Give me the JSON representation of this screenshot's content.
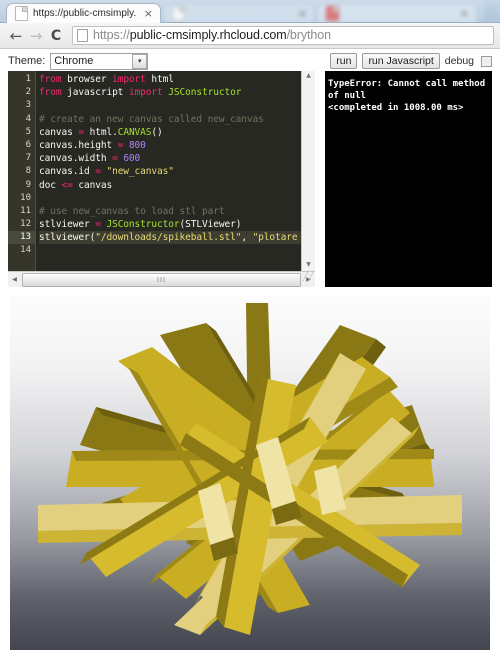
{
  "browser": {
    "tabs": [
      {
        "title": "https://public-cmsimply.",
        "close": "×",
        "state": "active"
      },
      {
        "title": "",
        "close": "×",
        "state": "blurred"
      },
      {
        "title": "",
        "close": "×",
        "state": "blurred"
      }
    ],
    "back_icon": "←",
    "forward_icon": "→",
    "reload_icon": "C",
    "url_scheme": "https://",
    "url_host": "public-cmsimply.rhcloud.com",
    "url_path": "/brython",
    "url_full": "https://public-cmsimply.rhcloud.com/brython"
  },
  "ide": {
    "theme_label": "Theme:",
    "theme_value": "Chrome",
    "theme_arrow": "▾",
    "run_label": "run",
    "run_js_label": "run Javascript",
    "debug_label": "debug"
  },
  "editor": {
    "line_numbers": [
      "1",
      "2",
      "3",
      "4",
      "5",
      "6",
      "7",
      "8",
      "9",
      "10",
      "11",
      "12",
      "13",
      "14"
    ],
    "active_line": 13,
    "lines": [
      "from browser import html",
      "from javascript import JSConstructor",
      "",
      "# create an new canvas called new_canvas",
      "canvas = html.CANVAS()",
      "canvas.height = 800",
      "canvas.width = 600",
      "canvas.id = \"new_canvas\"",
      "doc <= canvas",
      "",
      "# use new_canvas to load stl part",
      "stlviewer = JSConstructor(STLViewer)",
      "stlviewer(\"/downloads/spikeball.stl\", \"plotare",
      ""
    ],
    "scroll_up_arrow": "▲",
    "scroll_down_arrow": "▼",
    "scroll_left_arrow": "◀",
    "scroll_right_arrow": "▶",
    "thumb_grip": "III",
    "resize_grip": "╱╱"
  },
  "console": {
    "lines": [
      "TypeError: Cannot call method",
      "of null",
      "<completed in 1008.00 ms>"
    ]
  },
  "viewer": {
    "model_name": "spikeball.stl",
    "colors": {
      "bar_light": "#e8da8a",
      "bar_mid": "#d4b829",
      "bar_dark": "#8f7d16",
      "bar_shadow": "#6d5f10",
      "bg_top": "#fbfbfb",
      "bg_bottom": "#43454e"
    }
  }
}
